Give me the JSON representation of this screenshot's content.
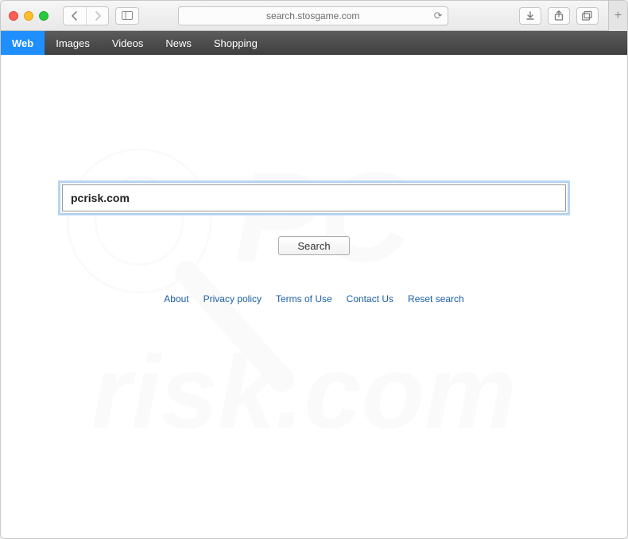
{
  "browser": {
    "address": "search.stosgame.com"
  },
  "tabs": {
    "items": [
      {
        "label": "Web",
        "active": true
      },
      {
        "label": "Images",
        "active": false
      },
      {
        "label": "Videos",
        "active": false
      },
      {
        "label": "News",
        "active": false
      },
      {
        "label": "Shopping",
        "active": false
      }
    ]
  },
  "search": {
    "value": "pcrisk.com",
    "button_label": "Search"
  },
  "footer": {
    "links": [
      {
        "label": "About"
      },
      {
        "label": "Privacy policy"
      },
      {
        "label": "Terms of Use"
      },
      {
        "label": "Contact Us"
      },
      {
        "label": "Reset search"
      }
    ]
  }
}
